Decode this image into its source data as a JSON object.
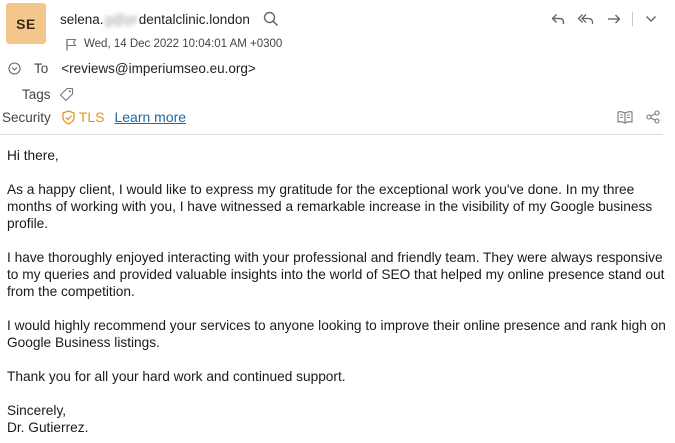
{
  "header": {
    "avatar_initials": "SE",
    "avatar_color": "#f3c78c",
    "from_prefix": "selena.",
    "from_obscured": "g@pr",
    "from_suffix": "dentalclinic.london",
    "date": "Wed, 14 Dec 2022 10:04:01 AM +0300",
    "actions": [
      "reply-icon",
      "reply-all-icon",
      "forward-icon",
      "more-chevron-icon"
    ]
  },
  "recipients": {
    "to_label": "To",
    "to_address": "<reviews@imperiumseo.eu.org>"
  },
  "tags": {
    "label": "Tags"
  },
  "security": {
    "label": "Security",
    "tls": "TLS",
    "tls_color": "#e8941c",
    "learn_more": "Learn more",
    "link_color": "#1a6aa8"
  },
  "message": {
    "greeting": "Hi there,",
    "p1": "As a happy client, I would like to express my gratitude for the exceptional work you've done. In my three months of working with you, I have witnessed a remarkable increase in the visibility of my Google business profile.",
    "p2": "I have thoroughly enjoyed interacting with your professional and friendly team. They were always responsive to my queries and provided valuable insights into the world of SEO that helped my online presence stand out from the competition.",
    "p3": "I would highly recommend your services to anyone looking to improve their online presence and rank high on Google Business listings.",
    "p4": "Thank you for all your hard work and continued support.",
    "closing": "Sincerely,",
    "signature": "Dr. Gutierrez."
  }
}
